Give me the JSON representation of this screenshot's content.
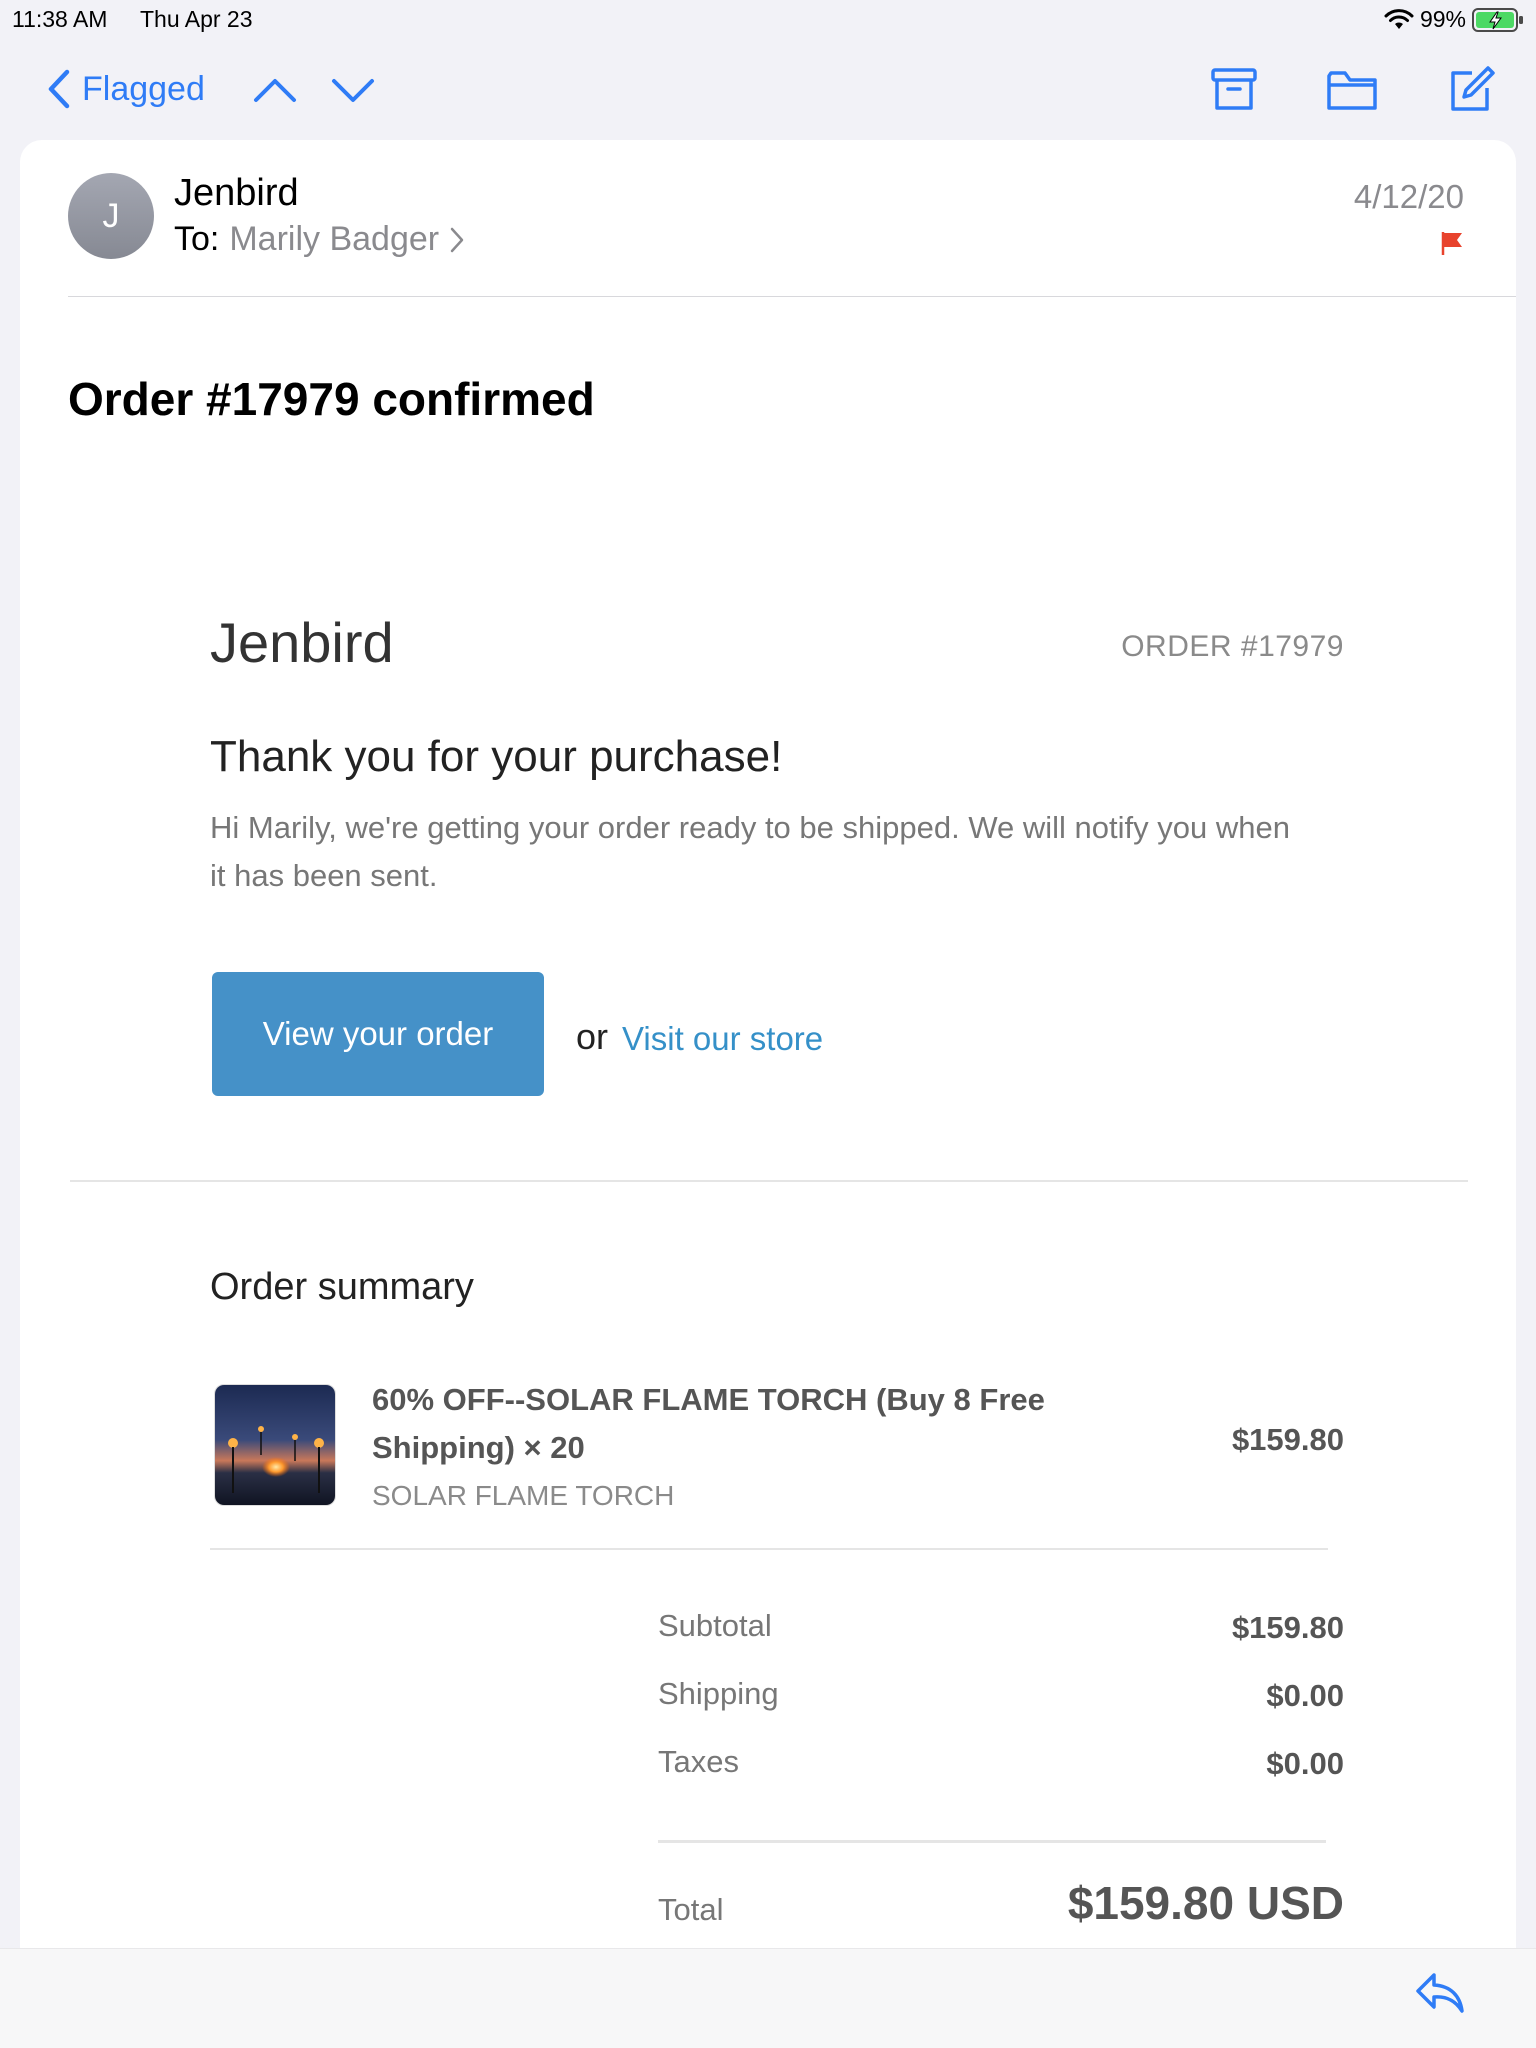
{
  "status_bar": {
    "time": "11:38 AM",
    "date": "Thu Apr 23",
    "battery": "99%",
    "wifi_icon": "wifi-icon",
    "battery_icon": "battery-charging-icon"
  },
  "nav": {
    "back_label": "Flagged",
    "icons": [
      "chevron-left-icon",
      "chevron-up-icon",
      "chevron-down-icon",
      "archive-icon",
      "folder-icon",
      "compose-icon"
    ],
    "accent_color": "#2f7cf6"
  },
  "message": {
    "avatar_initial": "J",
    "sender": "Jenbird",
    "to_label": "To:",
    "to_name": "Marily Badger",
    "date": "4/12/20",
    "flag_color": "#e8432d",
    "subject": "Order #17979 confirmed"
  },
  "email": {
    "store_name": "Jenbird",
    "order_number": "ORDER #17979",
    "thanks": "Thank you for your purchase!",
    "intro": "Hi Marily, we're getting your order ready to be shipped. We will notify you when it has been sent.",
    "view_button": "View your order",
    "or_text": "or",
    "store_link": "Visit our store",
    "button_color": "#4591c8",
    "summary_title": "Order summary",
    "item": {
      "title": "60% OFF--SOLAR FLAME TORCH (Buy 8 Free Shipping) × 20",
      "variant": "SOLAR FLAME TORCH",
      "price": "$159.80"
    },
    "totals": {
      "subtotal_label": "Subtotal",
      "subtotal": "$159.80",
      "shipping_label": "Shipping",
      "shipping": "$0.00",
      "taxes_label": "Taxes",
      "taxes": "$0.00",
      "total_label": "Total",
      "total": "$159.80 USD"
    }
  },
  "bottom": {
    "reply_icon": "reply-icon"
  }
}
